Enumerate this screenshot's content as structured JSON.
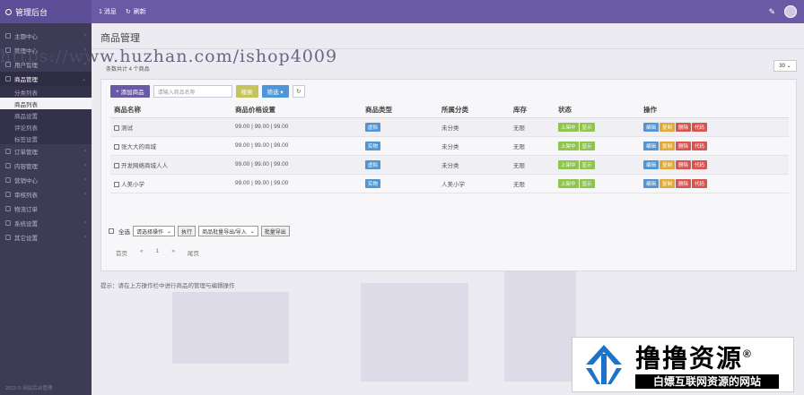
{
  "app": {
    "title": "管理后台"
  },
  "topnav": {
    "item1": "1 消息",
    "item2": "刷新"
  },
  "sidebar": {
    "items": [
      {
        "label": "主题中心"
      },
      {
        "label": "管理中心"
      },
      {
        "label": "用户管理"
      },
      {
        "label": "商品管理"
      },
      {
        "label": "订单管理"
      },
      {
        "label": "内容管理"
      },
      {
        "label": "营销中心"
      },
      {
        "label": "审核列表"
      },
      {
        "label": "物流订单"
      },
      {
        "label": "系统设置"
      },
      {
        "label": "其它设置"
      }
    ],
    "subitems": [
      "分类列表",
      "商品列表",
      "商品设置",
      "评论列表",
      "标签设置"
    ],
    "footer": "2023 © 网站后台管理"
  },
  "page": {
    "title": "商品管理",
    "count": "条数共计 4 个商品",
    "page_size": "30"
  },
  "watermark_url": "https://www.huzhan.com/ishop4009",
  "toolbar": {
    "add": "添加商品",
    "search_placeholder": "请输入商品名称",
    "search_btn": "搜索",
    "filter": "筛选 ▾"
  },
  "table": {
    "headers": [
      "商品名称",
      "商品价格设置",
      "商品类型",
      "所属分类",
      "库存",
      "状态",
      "操作"
    ],
    "rows": [
      {
        "name": "测试",
        "price": "99.00 | 99.00 | 99.00",
        "type": "虚拟",
        "category": "未分类",
        "stock": "无限"
      },
      {
        "name": "张大大的商城",
        "price": "99.00 | 99.00 | 99.00",
        "type": "实物",
        "category": "未分类",
        "stock": "无限"
      },
      {
        "name": "开发网络商城人人",
        "price": "99.00 | 99.00 | 99.00",
        "type": "虚拟",
        "category": "未分类",
        "stock": "无限"
      },
      {
        "name": "人美小学",
        "price": "99.00 | 99.00 | 99.00",
        "type": "实物",
        "category": "人美小学",
        "stock": "无限"
      }
    ],
    "status_tags": [
      "上架中",
      "显示"
    ],
    "ops": [
      "编辑",
      "复制",
      "删除",
      "代码"
    ]
  },
  "bulk": {
    "select_all": "全选",
    "action_select": "请选择操作",
    "exec": "执行",
    "batch_select": "商品批量导出/导入",
    "batch_btn": "批量导出"
  },
  "pagination": {
    "first": "首页",
    "prev": "«",
    "page": "1",
    "next": "»",
    "last": "尾页"
  },
  "hint": "提示：请在上方操作栏中进行商品的管理与编辑操作",
  "badge": {
    "title": "撸撸资源",
    "reg": "®",
    "subtitle": "白嫖互联网资源的网站"
  },
  "colors": {
    "topbar": "#6a5aa6",
    "sidebar": "#3d3b55",
    "accent_blue": "#4e96d8",
    "accent_green": "#8fc451",
    "accent_red": "#d9534f"
  }
}
